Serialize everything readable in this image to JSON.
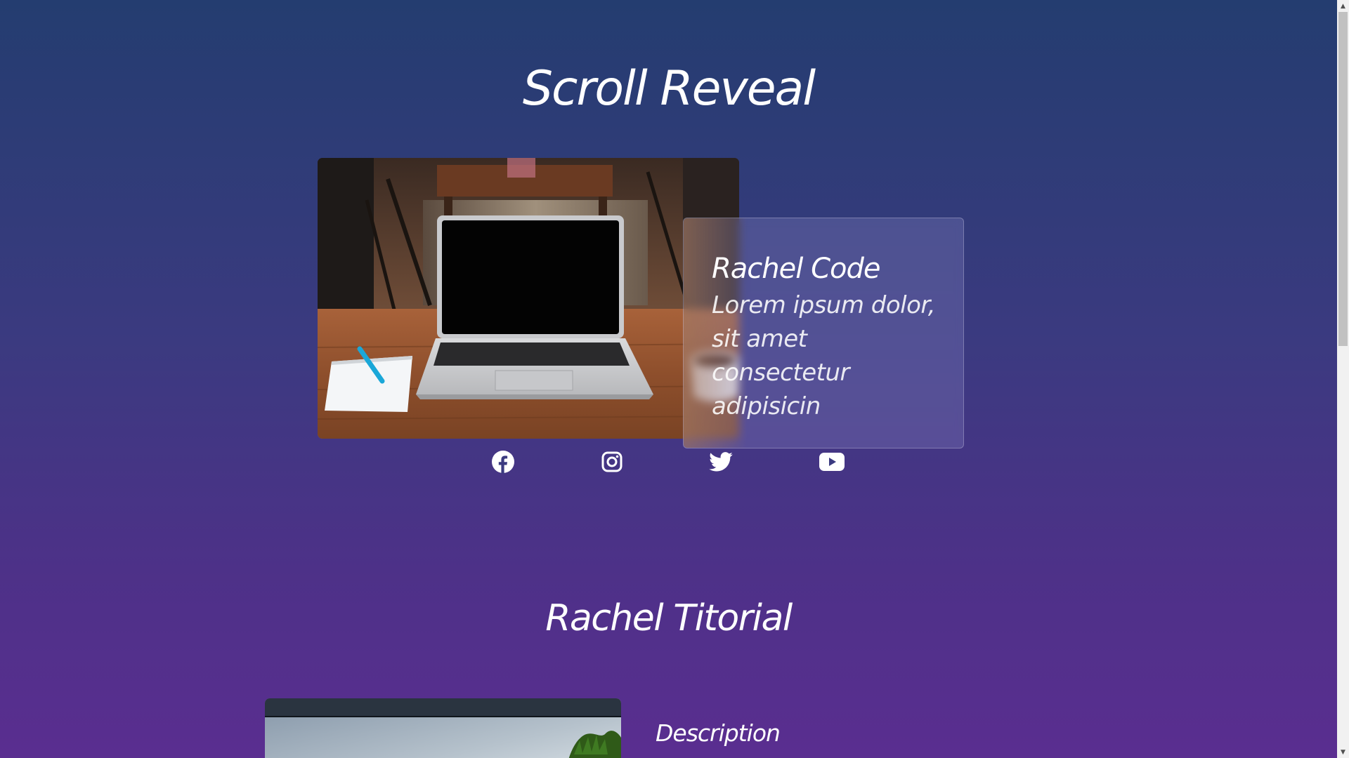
{
  "header": {
    "title": "Scroll Reveal"
  },
  "card": {
    "title": "Rachel Code",
    "body": "Lorem ipsum dolor, sit amet consectetur adipisicin"
  },
  "socials": [
    {
      "icon": "facebook-icon"
    },
    {
      "icon": "instagram-icon"
    },
    {
      "icon": "twitter-icon"
    },
    {
      "icon": "youtube-icon"
    }
  ],
  "section2": {
    "title": "Rachel Titorial",
    "description_label": "Description"
  },
  "colors": {
    "background_top": "#243d70",
    "background_bottom": "#5a2e90",
    "text": "#ffffff"
  }
}
